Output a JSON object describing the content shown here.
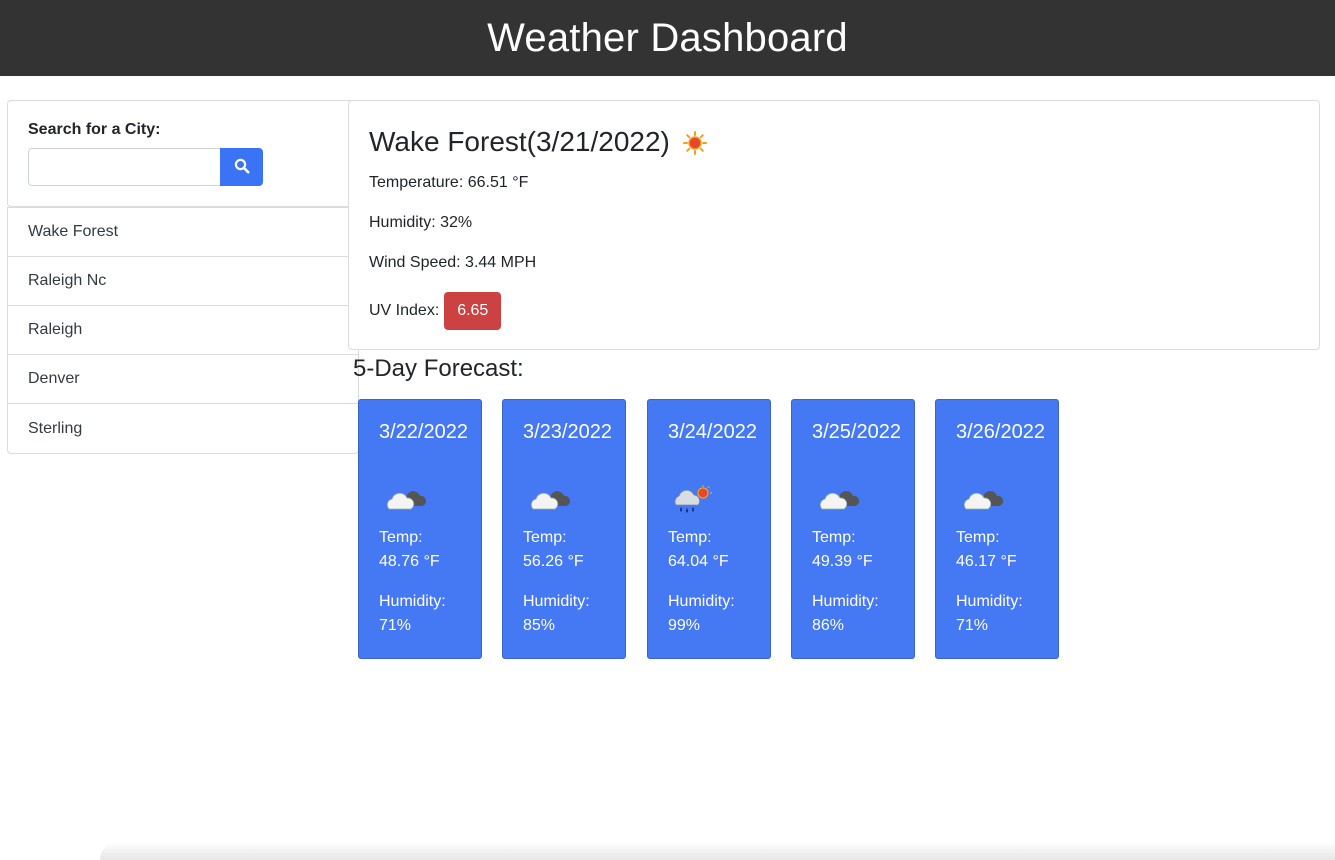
{
  "header": {
    "title": "Weather Dashboard"
  },
  "search": {
    "label": "Search for a City:",
    "value": "",
    "placeholder": "",
    "button_icon": "search-icon"
  },
  "history": [
    "Wake Forest",
    "Raleigh Nc",
    "Raleigh",
    "Denver",
    "Sterling"
  ],
  "current": {
    "title": "Wake Forest(3/21/2022)",
    "icon": "sun-icon",
    "temperature": "Temperature: 66.51 °F",
    "humidity": "Humidity: 32%",
    "wind": "Wind Speed: 3.44 MPH",
    "uv_label": "UV Index:",
    "uv_value": "6.65",
    "uv_color": "#cc4141"
  },
  "forecast_title": "5-Day Forecast:",
  "forecast": [
    {
      "date": "3/22/2022",
      "icon": "cloudy-icon",
      "temp_label": "Temp:",
      "temp": "48.76 °F",
      "hum_label": "Humidity:",
      "humidity": "71%"
    },
    {
      "date": "3/23/2022",
      "icon": "cloudy-icon",
      "temp_label": "Temp:",
      "temp": "56.26 °F",
      "hum_label": "Humidity:",
      "humidity": "85%"
    },
    {
      "date": "3/24/2022",
      "icon": "rain-icon",
      "temp_label": "Temp:",
      "temp": "64.04 °F",
      "hum_label": "Humidity:",
      "humidity": "99%"
    },
    {
      "date": "3/25/2022",
      "icon": "cloudy-icon",
      "temp_label": "Temp:",
      "temp": "49.39 °F",
      "hum_label": "Humidity:",
      "humidity": "86%"
    },
    {
      "date": "3/26/2022",
      "icon": "cloudy-icon",
      "temp_label": "Temp:",
      "temp": "46.17 °F",
      "hum_label": "Humidity:",
      "humidity": "71%"
    }
  ],
  "colors": {
    "header_bg": "#333333",
    "accent": "#3b73f7",
    "forecast_bg": "#4479f3"
  }
}
